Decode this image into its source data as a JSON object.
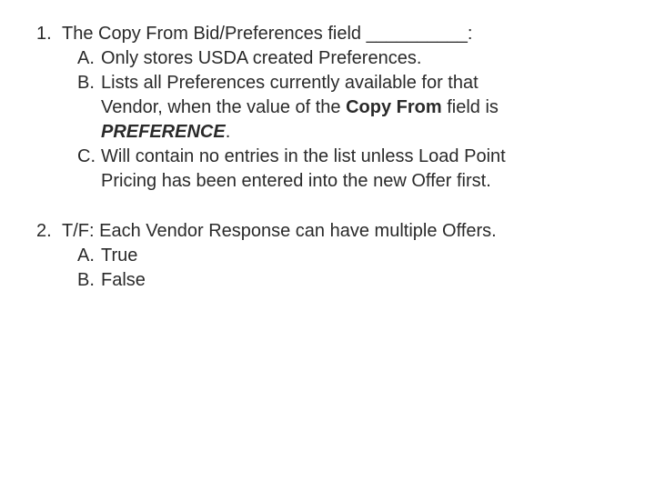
{
  "q1": {
    "num": "1.",
    "stem_pre": "The Copy From Bid/Preferences field ",
    "blank": "__________",
    "stem_post": ":",
    "a_letter": "A.",
    "a_text": "Only stores USDA created Preferences.",
    "b_letter": "B.",
    "b_line1_pre": "Lists all Preferences currently available for that",
    "b_line2_pre": "Vendor, when the value of the ",
    "b_line2_bold": "Copy From",
    "b_line2_post": " field is",
    "b_line3_bolditalic": "PREFERENCE",
    "b_line3_post": ".",
    "c_letter": "C.",
    "c_line1": "Will contain no entries in the list unless Load Point",
    "c_line2": "Pricing has been entered into the new Offer first."
  },
  "q2": {
    "num": "2.",
    "stem": "T/F: Each Vendor Response can have multiple Offers.",
    "a_letter": "A.",
    "a_text": "True",
    "b_letter": "B.",
    "b_text": "False"
  }
}
